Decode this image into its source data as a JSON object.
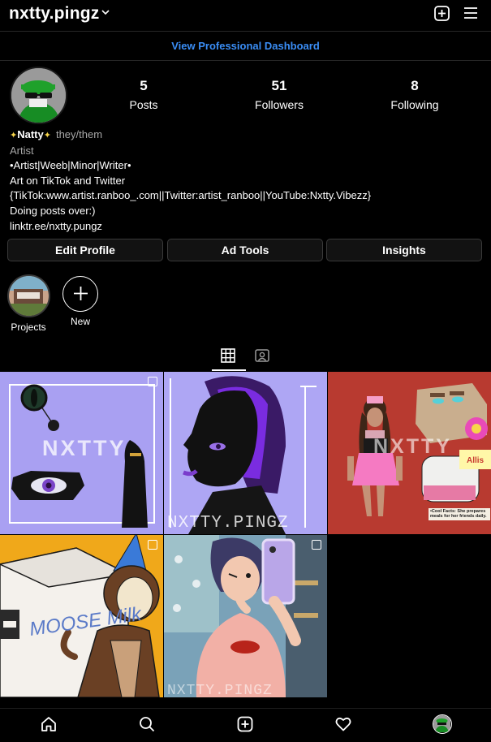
{
  "header": {
    "username": "nxtty.pingz",
    "chevron_icon": "chevron-down-icon",
    "add_icon": "plus-square-icon",
    "menu_icon": "hamburger-menu-icon"
  },
  "dashboard": {
    "label": "View Professional Dashboard"
  },
  "profile": {
    "stats": [
      {
        "value": "5",
        "label": "Posts"
      },
      {
        "value": "51",
        "label": "Followers"
      },
      {
        "value": "8",
        "label": "Following"
      }
    ],
    "name": "Natty",
    "pronouns": "they/them",
    "category": "Artist",
    "bio_lines": [
      "•Artist|Weeb|Minor|Writer•",
      "Art on TikTok and Twitter",
      "{TikTok:www.artist.ranboo_.com||Twitter:artist_ranboo||YouTube:Nxtty.Vibezz}",
      "Doing posts over:)"
    ],
    "link": "linktr.ee/nxtty.pungz"
  },
  "buttons": {
    "edit_profile": "Edit Profile",
    "ad_tools": "Ad Tools",
    "insights": "Insights"
  },
  "highlights": [
    {
      "label": "Projects"
    },
    {
      "label": "New"
    }
  ],
  "posts": [
    {
      "watermark": "NXTTY",
      "multi": true
    },
    {
      "watermark": "NXTTY.PINGZ",
      "multi": false
    },
    {
      "watermark": "NXTTY",
      "sticker": "Allis",
      "caption": "•Cool Facts: She prepares meals for her friends daily.",
      "multi": false
    },
    {
      "watermark": "MOOSE Milk",
      "multi": true
    },
    {
      "watermark": "NXTTY.PINGZ",
      "multi": true
    }
  ],
  "nav": {
    "items": [
      "home-icon",
      "search-icon",
      "create-icon",
      "heart-icon",
      "profile-avatar"
    ]
  },
  "colors": {
    "background": "#000000",
    "link_blue": "#3a8df5",
    "button_bg": "#121212",
    "muted_text": "#a8a8a8"
  }
}
